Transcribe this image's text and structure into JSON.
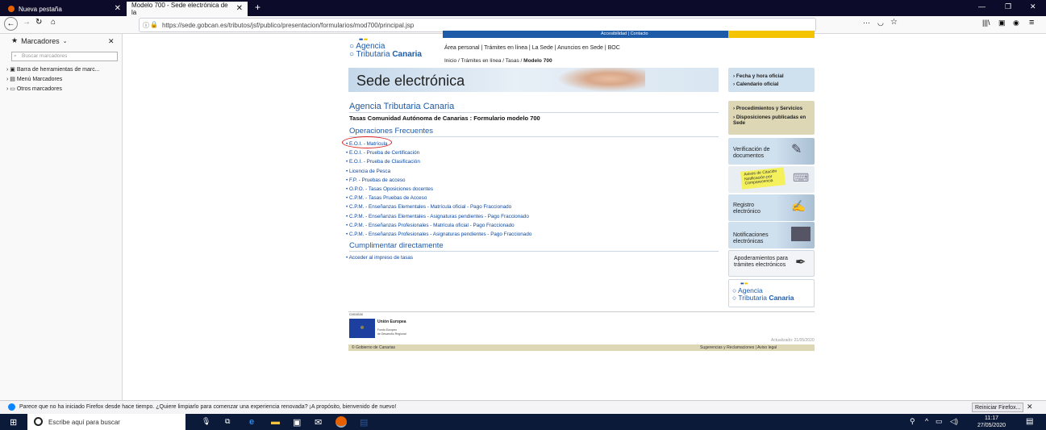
{
  "tabs": [
    {
      "label": "Nueva pestaña"
    },
    {
      "label": "Modelo 700 - Sede electrónica de la"
    }
  ],
  "url": "https://sede.gobcan.es/tributos/jsf/publico/presentacion/formularios/mod700/principal.jsp",
  "sidebar": {
    "title": "Marcadores",
    "search_placeholder": "Buscar marcadores",
    "items": [
      {
        "label": "Barra de herramientas de marc..."
      },
      {
        "label": "Menú Marcadores"
      },
      {
        "label": "Otros marcadores"
      }
    ]
  },
  "site": {
    "top_links": "Accesibilidad | Contacto",
    "logo_line1": "Agencia",
    "logo_line2a": "Tributaria ",
    "logo_line2b": "Canaria",
    "nav": "Área personal | Trámites en línea | La Sede | Anuncios en Sede | BOC",
    "breadcrumb_prefix": "Inicio / Trámites en línea / Tasas / ",
    "breadcrumb_current": "Modelo 700",
    "banner": "Sede electrónica",
    "heading": "Agencia Tributaria Canaria",
    "subheading": "Tasas Comunidad Autónoma de Canarias : Formulario modelo 700",
    "section1": "Operaciones Frecuentes",
    "operations": [
      "E.O.I. - Matrícula",
      "E.O.I. - Prueba de Certificación",
      "E.O.I. - Prueba de Clasificación",
      "Licencia de Pesca",
      "F.P. - Pruebas de acceso",
      "O.P.O. - Tasas Oposiciones docentes",
      "C.P.M. - Tasas Pruebas de Acceso",
      "C.P.M. - Enseñanzas Elementales - Matrícula oficial - Pago Fraccionado",
      "C.P.M. - Enseñanzas Elementales - Asignaturas pendientes - Pago Fraccionado",
      "C.P.M. - Enseñanzas Profesionales - Matrícula oficial - Pago Fraccionado",
      "C.P.M. - Enseñanzas Profesionales - Asignaturas pendientes - Pago Fraccionado"
    ],
    "section2": "Cumplimentar directamente",
    "direct_link": "Acceder al impreso de tasas",
    "right": {
      "fecha": "› Fecha y hora oficial",
      "calendario": "› Calendario oficial",
      "procedimientos": "› Procedimientos y Servicios",
      "disposiciones": "› Disposiciones publicadas en Sede",
      "verificacion": "Verificación de documentos",
      "avisos": "Avisos de Citación Notificación por Comparecencia",
      "registro": "Registro electrónico",
      "notificaciones": "Notificaciones electrónicas",
      "apoderamientos": "Apoderamientos para trámites electrónicos",
      "logo_line1": "Agencia",
      "logo_line2a": "Tributaria ",
      "logo_line2b": "Canaria"
    },
    "footer": {
      "canarias": "canarias",
      "eu_title": "Unión Europea",
      "eu_sub1": "Fondo Europeo",
      "eu_sub2": "de Desarrollo Regional",
      "updated": "Actualizado: 21/05/2020",
      "copyright": "© Gobierno de Canarias",
      "links": "Sugerencias y Reclamaciones | Aviso legal"
    }
  },
  "notification": {
    "text": "Parece que no ha iniciado Firefox desde hace tiempo. ¿Quiere limpiarlo para comenzar una experiencia renovada? ¡A propósito, bienvenido de nuevo!",
    "button": "Reiniciar Firefox..."
  },
  "taskbar": {
    "search_placeholder": "Escribe aquí para buscar",
    "time": "11:17",
    "date": "27/05/2020"
  },
  "colors": {
    "accent_yellow": "#f5c400",
    "brand_blue": "#1d5aa8"
  }
}
